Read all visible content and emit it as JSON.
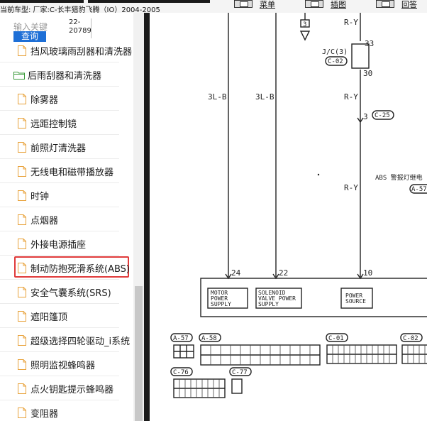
{
  "topbar": {
    "status": "当前车型:  厂家:C-长丰猎豹飞腾（IO）2004-2005",
    "buttons": [
      {
        "label": "菜单"
      },
      {
        "label": "插图"
      },
      {
        "label": "回答"
      }
    ]
  },
  "search": {
    "label": "输入关键",
    "value": "22-20789",
    "button": "查询"
  },
  "tree": {
    "items": [
      {
        "label": "挡风玻璃雨刮器和清洗器",
        "type": "doc"
      },
      {
        "label": "后雨刮器和清洗器",
        "type": "folder"
      },
      {
        "label": "除雾器",
        "type": "doc"
      },
      {
        "label": "远距控制镜",
        "type": "doc"
      },
      {
        "label": "前照灯清洗器",
        "type": "doc"
      },
      {
        "label": "无线电和磁带播放器",
        "type": "doc"
      },
      {
        "label": "时钟",
        "type": "doc"
      },
      {
        "label": "点烟器",
        "type": "doc"
      },
      {
        "label": "外接电源插座",
        "type": "doc"
      },
      {
        "label": "制动防抱死滑系统(ABS)",
        "type": "doc",
        "selected": true
      },
      {
        "label": "安全气囊系统(SRS)",
        "type": "doc"
      },
      {
        "label": "遮阳篷顶",
        "type": "doc"
      },
      {
        "label": "超级选择四轮驱动_i系统",
        "type": "doc"
      },
      {
        "label": "照明监视蜂鸣器",
        "type": "doc"
      },
      {
        "label": "点火钥匙提示蜂鸣器",
        "type": "doc"
      },
      {
        "label": "变阻器",
        "type": "doc"
      }
    ]
  },
  "diagram": {
    "wires": [
      {
        "label": "3L-B"
      },
      {
        "label": "3L-B"
      },
      {
        "label": "R-Y"
      },
      {
        "label": "R-Y"
      },
      {
        "label": "R-Y"
      }
    ],
    "pins": [
      "24",
      "22",
      "10",
      "33",
      "30",
      "3",
      "3"
    ],
    "jc": "J/C(3)",
    "connectors_top": [
      "C-02",
      "C-25",
      "A-57"
    ],
    "abs_note": "ABS 警报灯继电",
    "blocks": [
      {
        "lines": [
          "MOTOR",
          "POWER",
          "SUPPLY"
        ]
      },
      {
        "lines": [
          "SOLENOID",
          "VALVE POWER",
          "SUPPLY"
        ]
      },
      {
        "lines": [
          "POWER",
          "SOURCE"
        ]
      }
    ],
    "connectors_bottom": [
      "A-57",
      "A-58",
      "C-01",
      "C-02",
      "C-76",
      "C-77"
    ]
  },
  "colors": {
    "selection_border": "#e03a3a",
    "search_button": "#1e6fd6",
    "divider": "#1b1b1b"
  }
}
